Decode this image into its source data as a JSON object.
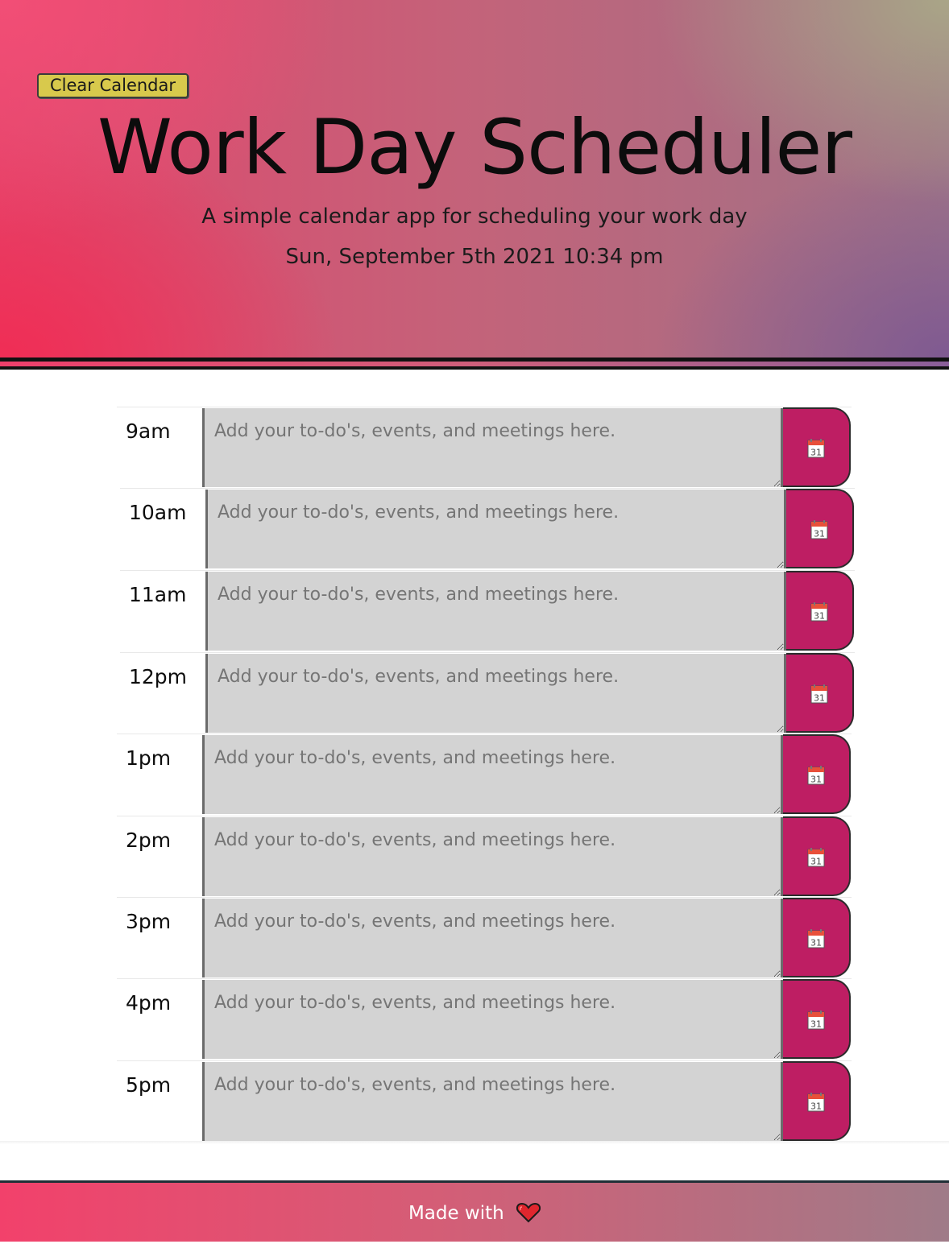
{
  "header": {
    "clear_label": "Clear Calendar",
    "title": "Work Day Scheduler",
    "subtitle": "A simple calendar app for scheduling your work day",
    "datetime": "Sun, September 5th 2021 10:34 pm"
  },
  "schedule": {
    "placeholder": "Add your to-do's, events, and meetings here.",
    "save_icon": "calendar-31-icon",
    "rows": [
      {
        "hour": "9am",
        "task": ""
      },
      {
        "hour": "10am",
        "task": ""
      },
      {
        "hour": "11am",
        "task": ""
      },
      {
        "hour": "12pm",
        "task": ""
      },
      {
        "hour": "1pm",
        "task": ""
      },
      {
        "hour": "2pm",
        "task": ""
      },
      {
        "hour": "3pm",
        "task": ""
      },
      {
        "hour": "4pm",
        "task": ""
      },
      {
        "hour": "5pm",
        "task": ""
      }
    ]
  },
  "footer": {
    "text": "Made with",
    "icon": "heart-icon"
  },
  "colors": {
    "save_button": "#be1e63",
    "task_background": "#d3d3d3",
    "clear_button": "#d8c94c",
    "header_pink": "#f24e76",
    "header_purple": "#7d5892"
  }
}
